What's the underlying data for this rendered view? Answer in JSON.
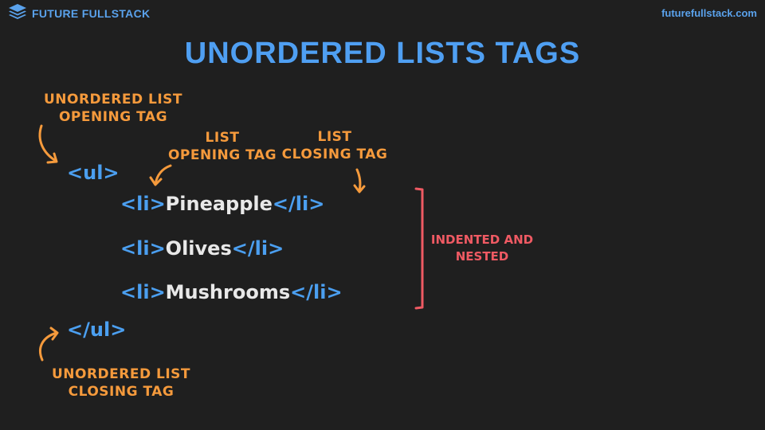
{
  "header": {
    "brand_name": "FUTURE FULLSTACK",
    "site_url": "futurefullstack.com"
  },
  "title": "UNORDERED LISTS TAGS",
  "annotations": {
    "ul_opening": "UNORDERED LIST\nOPENING TAG",
    "li_opening": "LIST\nOPENING TAG",
    "li_closing": "LIST\nCLOSING TAG",
    "indented": "INDENTED AND\nNESTED",
    "ul_closing": "UNORDERED LIST\nCLOSING TAG"
  },
  "code": {
    "ul_open": "<ul>",
    "li_open": "<li>",
    "li_close": "</li>",
    "items": [
      "Pineapple",
      "Olives",
      "Mushrooms"
    ],
    "ul_close": "</ul>"
  },
  "colors": {
    "background": "#1f1f1f",
    "tag_blue": "#4b9ff0",
    "annotation_orange": "#f59a3c",
    "annotation_red": "#ef5a63",
    "item_text": "#e8e8e8"
  }
}
